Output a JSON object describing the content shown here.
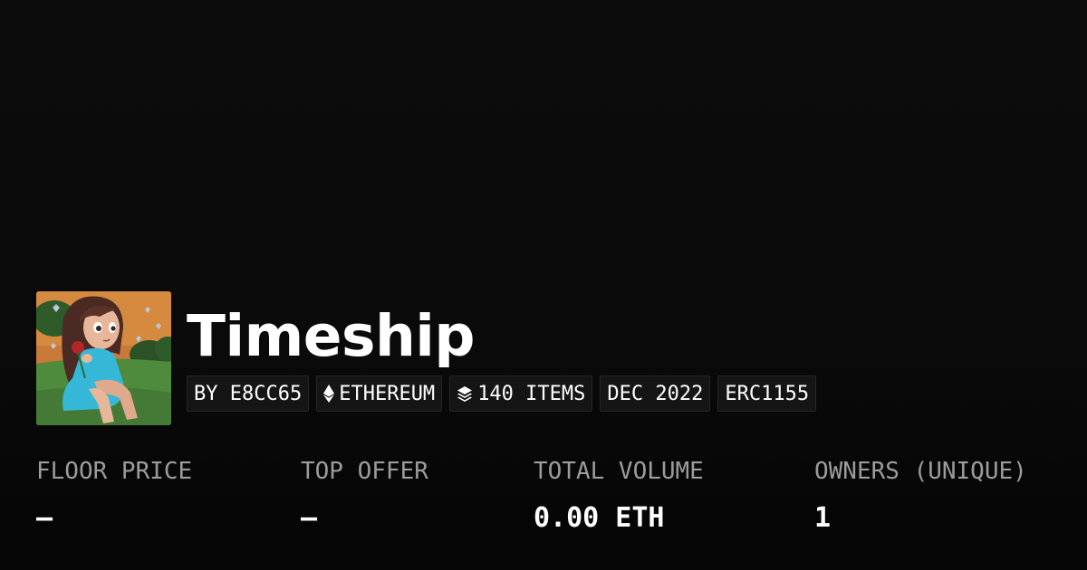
{
  "collection": {
    "name": "Timeship"
  },
  "tags": {
    "creator": "BY E8CC65",
    "chain": "ETHEREUM",
    "items": "140 ITEMS",
    "date": "DEC 2022",
    "standard": "ERC1155"
  },
  "stats": {
    "floor_price": {
      "label": "FLOOR PRICE",
      "value": "–"
    },
    "top_offer": {
      "label": "TOP OFFER",
      "value": "–"
    },
    "total_volume": {
      "label": "TOTAL VOLUME",
      "value": "0.00 ETH"
    },
    "owners": {
      "label": "OWNERS (UNIQUE)",
      "value": "1"
    }
  },
  "icons": {
    "chain": "ethereum-icon",
    "items": "layers-icon"
  },
  "colors": {
    "background": "#0a0a0a",
    "tag_background": "#151515",
    "label_gray": "#9c9c9c",
    "text": "#ffffff"
  }
}
